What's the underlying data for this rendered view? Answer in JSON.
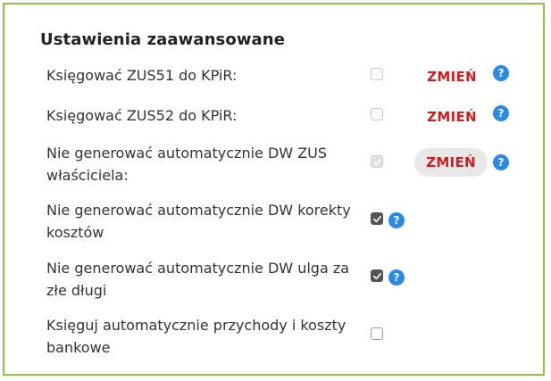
{
  "section": {
    "title": "Ustawienia zaawansowane"
  },
  "settings": [
    {
      "label": "Księgować ZUS51 do KPiR:",
      "checked": false,
      "disabled": true,
      "change_label": "ZMIEŃ",
      "help": "?"
    },
    {
      "label": "Księgować ZUS52 do KPiR:",
      "checked": false,
      "disabled": true,
      "change_label": "ZMIEŃ",
      "help": "?"
    },
    {
      "label": "Nie generować automatycznie DW ZUS właściciela:",
      "checked": true,
      "disabled": true,
      "change_label": "ZMIEŃ",
      "help": "?"
    },
    {
      "label": "Nie generować automatycznie DW korekty kosztów",
      "checked": true,
      "disabled": false,
      "help": "?"
    },
    {
      "label": "Nie generować automatycznie DW ulga za złe długi",
      "checked": true,
      "disabled": false,
      "help": "?"
    },
    {
      "label": "Księguj automatycznie przychody i koszty bankowe",
      "checked": false,
      "disabled": false
    }
  ],
  "colors": {
    "border": "#8dc63f",
    "change_text": "#cc1f1f",
    "help_badge": "#2a8ae6",
    "checkbox_checked": "#555555"
  },
  "icons": {
    "help": "question-circle-icon",
    "check": "checkmark-icon"
  }
}
